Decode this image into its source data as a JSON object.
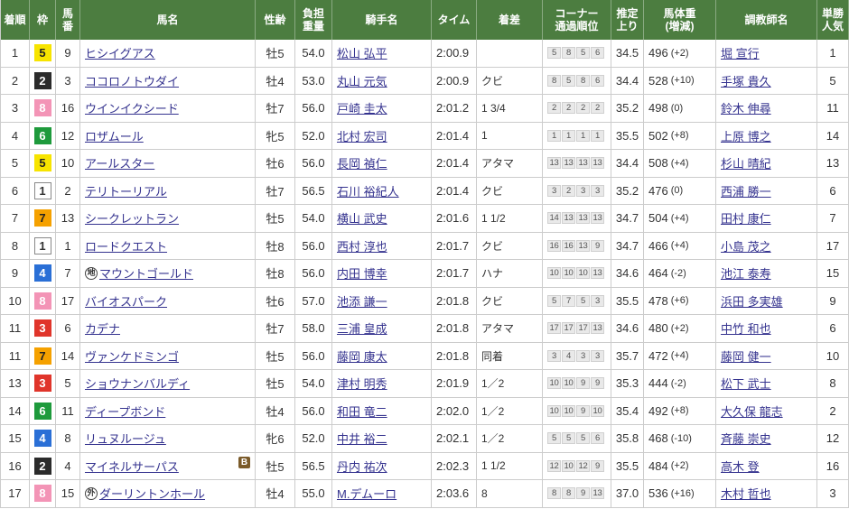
{
  "colors": {
    "header_bg": "#4c7d40",
    "link": "#35338f",
    "blinker": "#7b5b2a",
    "waku": {
      "1": {
        "bg": "#ffffff",
        "fg": "#333333",
        "border": "#888888"
      },
      "2": {
        "bg": "#2b2b2b",
        "fg": "#ffffff"
      },
      "3": {
        "bg": "#e0352b",
        "fg": "#ffffff"
      },
      "4": {
        "bg": "#2a6fd6",
        "fg": "#ffffff"
      },
      "5": {
        "bg": "#f7e400",
        "fg": "#222222"
      },
      "6": {
        "bg": "#1e9a3c",
        "fg": "#ffffff"
      },
      "7": {
        "bg": "#f5a100",
        "fg": "#222222"
      },
      "8": {
        "bg": "#f394b6",
        "fg": "#ffffff"
      }
    }
  },
  "table": {
    "headers": {
      "rank": [
        "着順"
      ],
      "waku": [
        "枠"
      ],
      "umaban": [
        "馬",
        "番"
      ],
      "name": [
        "馬名"
      ],
      "sex_age": [
        "性齢"
      ],
      "weight": [
        "負担",
        "重量"
      ],
      "jockey": [
        "騎手名"
      ],
      "time": [
        "タイム"
      ],
      "margin": [
        "着差"
      ],
      "corners": [
        "コーナー",
        "通過順位"
      ],
      "last3f": [
        "推定",
        "上り"
      ],
      "body_weight": [
        "馬体重",
        "(増減)"
      ],
      "trainer": [
        "調教師名"
      ],
      "popularity": [
        "単勝",
        "人気"
      ]
    },
    "rows": [
      {
        "rank": "1",
        "waku": "5",
        "umaban": "9",
        "name": "ヒシイグアス",
        "sex_age": "牡5",
        "weight": "54.0",
        "jockey": "松山 弘平",
        "time": "2:00.9",
        "margin": "",
        "corners": [
          "5",
          "8",
          "5",
          "6"
        ],
        "last3f": "34.5",
        "body_weight": "496",
        "body_weight_diff": "(+2)",
        "trainer": "堀 宣行",
        "popularity": "1"
      },
      {
        "rank": "2",
        "waku": "2",
        "umaban": "3",
        "name": "ココロノトウダイ",
        "sex_age": "牡4",
        "weight": "53.0",
        "jockey": "丸山 元気",
        "time": "2:00.9",
        "margin": "クビ",
        "corners": [
          "8",
          "5",
          "8",
          "6"
        ],
        "last3f": "34.4",
        "body_weight": "528",
        "body_weight_diff": "(+10)",
        "trainer": "手塚 貴久",
        "popularity": "5"
      },
      {
        "rank": "3",
        "waku": "8",
        "umaban": "16",
        "name": "ウインイクシード",
        "sex_age": "牡7",
        "weight": "56.0",
        "jockey": "戸崎 圭太",
        "time": "2:01.2",
        "margin": "1 3/4",
        "corners": [
          "2",
          "2",
          "2",
          "2"
        ],
        "last3f": "35.2",
        "body_weight": "498",
        "body_weight_diff": "(0)",
        "trainer": "鈴木 伸尋",
        "popularity": "11"
      },
      {
        "rank": "4",
        "waku": "6",
        "umaban": "12",
        "name": "ロザムール",
        "sex_age": "牝5",
        "weight": "52.0",
        "jockey": "北村 宏司",
        "time": "2:01.4",
        "margin": "1",
        "corners": [
          "1",
          "1",
          "1",
          "1"
        ],
        "last3f": "35.5",
        "body_weight": "502",
        "body_weight_diff": "(+8)",
        "trainer": "上原 博之",
        "popularity": "14"
      },
      {
        "rank": "5",
        "waku": "5",
        "umaban": "10",
        "name": "アールスター",
        "sex_age": "牡6",
        "weight": "56.0",
        "jockey": "長岡 禎仁",
        "time": "2:01.4",
        "margin": "アタマ",
        "corners": [
          "13",
          "13",
          "13",
          "13"
        ],
        "last3f": "34.4",
        "body_weight": "508",
        "body_weight_diff": "(+4)",
        "trainer": "杉山 晴紀",
        "popularity": "13"
      },
      {
        "rank": "6",
        "waku": "1",
        "umaban": "2",
        "name": "テリトーリアル",
        "sex_age": "牡7",
        "weight": "56.5",
        "jockey": "石川 裕紀人",
        "time": "2:01.4",
        "margin": "クビ",
        "corners": [
          "3",
          "2",
          "3",
          "3"
        ],
        "last3f": "35.2",
        "body_weight": "476",
        "body_weight_diff": "(0)",
        "trainer": "西浦 勝一",
        "popularity": "6"
      },
      {
        "rank": "7",
        "waku": "7",
        "umaban": "13",
        "name": "シークレットラン",
        "sex_age": "牡5",
        "weight": "54.0",
        "jockey": "横山 武史",
        "time": "2:01.6",
        "margin": "1 1/2",
        "corners": [
          "14",
          "13",
          "13",
          "13"
        ],
        "last3f": "34.7",
        "body_weight": "504",
        "body_weight_diff": "(+4)",
        "trainer": "田村 康仁",
        "popularity": "7"
      },
      {
        "rank": "8",
        "waku": "1",
        "umaban": "1",
        "name": "ロードクエスト",
        "sex_age": "牡8",
        "weight": "56.0",
        "jockey": "西村 淳也",
        "time": "2:01.7",
        "margin": "クビ",
        "corners": [
          "16",
          "16",
          "13",
          "9"
        ],
        "last3f": "34.7",
        "body_weight": "466",
        "body_weight_diff": "(+4)",
        "trainer": "小島 茂之",
        "popularity": "17"
      },
      {
        "rank": "9",
        "waku": "4",
        "umaban": "7",
        "mark": "地",
        "mark_icon": "chiho-horse-mark-icon",
        "name": "マウントゴールド",
        "sex_age": "牡8",
        "weight": "56.0",
        "jockey": "内田 博幸",
        "time": "2:01.7",
        "margin": "ハナ",
        "corners": [
          "10",
          "10",
          "10",
          "13"
        ],
        "last3f": "34.6",
        "body_weight": "464",
        "body_weight_diff": "(-2)",
        "trainer": "池江 泰寿",
        "popularity": "15"
      },
      {
        "rank": "10",
        "waku": "8",
        "umaban": "17",
        "name": "バイオスパーク",
        "sex_age": "牡6",
        "weight": "57.0",
        "jockey": "池添 謙一",
        "time": "2:01.8",
        "margin": "クビ",
        "corners": [
          "5",
          "7",
          "5",
          "3"
        ],
        "last3f": "35.5",
        "body_weight": "478",
        "body_weight_diff": "(+6)",
        "trainer": "浜田 多実雄",
        "popularity": "9"
      },
      {
        "rank": "11",
        "waku": "3",
        "umaban": "6",
        "name": "カデナ",
        "sex_age": "牡7",
        "weight": "58.0",
        "jockey": "三浦 皇成",
        "time": "2:01.8",
        "margin": "アタマ",
        "corners": [
          "17",
          "17",
          "17",
          "13"
        ],
        "last3f": "34.6",
        "body_weight": "480",
        "body_weight_diff": "(+2)",
        "trainer": "中竹 和也",
        "popularity": "6"
      },
      {
        "rank": "11",
        "waku": "7",
        "umaban": "14",
        "name": "ヴァンケドミンゴ",
        "sex_age": "牡5",
        "weight": "56.0",
        "jockey": "藤岡 康太",
        "time": "2:01.8",
        "margin": "同着",
        "corners": [
          "3",
          "4",
          "3",
          "3"
        ],
        "last3f": "35.7",
        "body_weight": "472",
        "body_weight_diff": "(+4)",
        "trainer": "藤岡 健一",
        "popularity": "10"
      },
      {
        "rank": "13",
        "waku": "3",
        "umaban": "5",
        "name": "ショウナンバルディ",
        "sex_age": "牡5",
        "weight": "54.0",
        "jockey": "津村 明秀",
        "time": "2:01.9",
        "margin": "1／2",
        "corners": [
          "10",
          "10",
          "9",
          "9"
        ],
        "last3f": "35.3",
        "body_weight": "444",
        "body_weight_diff": "(-2)",
        "trainer": "松下 武士",
        "popularity": "8"
      },
      {
        "rank": "14",
        "waku": "6",
        "umaban": "11",
        "name": "ディープボンド",
        "sex_age": "牡4",
        "weight": "56.0",
        "jockey": "和田 竜二",
        "time": "2:02.0",
        "margin": "1／2",
        "corners": [
          "10",
          "10",
          "9",
          "10"
        ],
        "last3f": "35.4",
        "body_weight": "492",
        "body_weight_diff": "(+8)",
        "trainer": "大久保 龍志",
        "popularity": "2"
      },
      {
        "rank": "15",
        "waku": "4",
        "umaban": "8",
        "name": "リュヌルージュ",
        "sex_age": "牝6",
        "weight": "52.0",
        "jockey": "中井 裕二",
        "time": "2:02.1",
        "margin": "1／2",
        "corners": [
          "5",
          "5",
          "5",
          "6"
        ],
        "last3f": "35.8",
        "body_weight": "468",
        "body_weight_diff": "(-10)",
        "trainer": "斉藤 崇史",
        "popularity": "12"
      },
      {
        "rank": "16",
        "waku": "2",
        "umaban": "4",
        "name": "マイネルサーパス",
        "blinker": "B",
        "sex_age": "牡5",
        "weight": "56.5",
        "jockey": "丹内 祐次",
        "time": "2:02.3",
        "margin": "1 1/2",
        "corners": [
          "12",
          "10",
          "12",
          "9"
        ],
        "last3f": "35.5",
        "body_weight": "484",
        "body_weight_diff": "(+2)",
        "trainer": "高木 登",
        "popularity": "16"
      },
      {
        "rank": "17",
        "waku": "8",
        "umaban": "15",
        "mark": "外",
        "mark_icon": "foreign-bred-mark-icon",
        "name": "ダーリントンホール",
        "sex_age": "牡4",
        "weight": "55.0",
        "jockey": "M.デムーロ",
        "time": "2:03.6",
        "margin": "8",
        "corners": [
          "8",
          "8",
          "9",
          "13"
        ],
        "last3f": "37.0",
        "body_weight": "536",
        "body_weight_diff": "(+16)",
        "trainer": "木村 哲也",
        "popularity": "3"
      }
    ]
  }
}
